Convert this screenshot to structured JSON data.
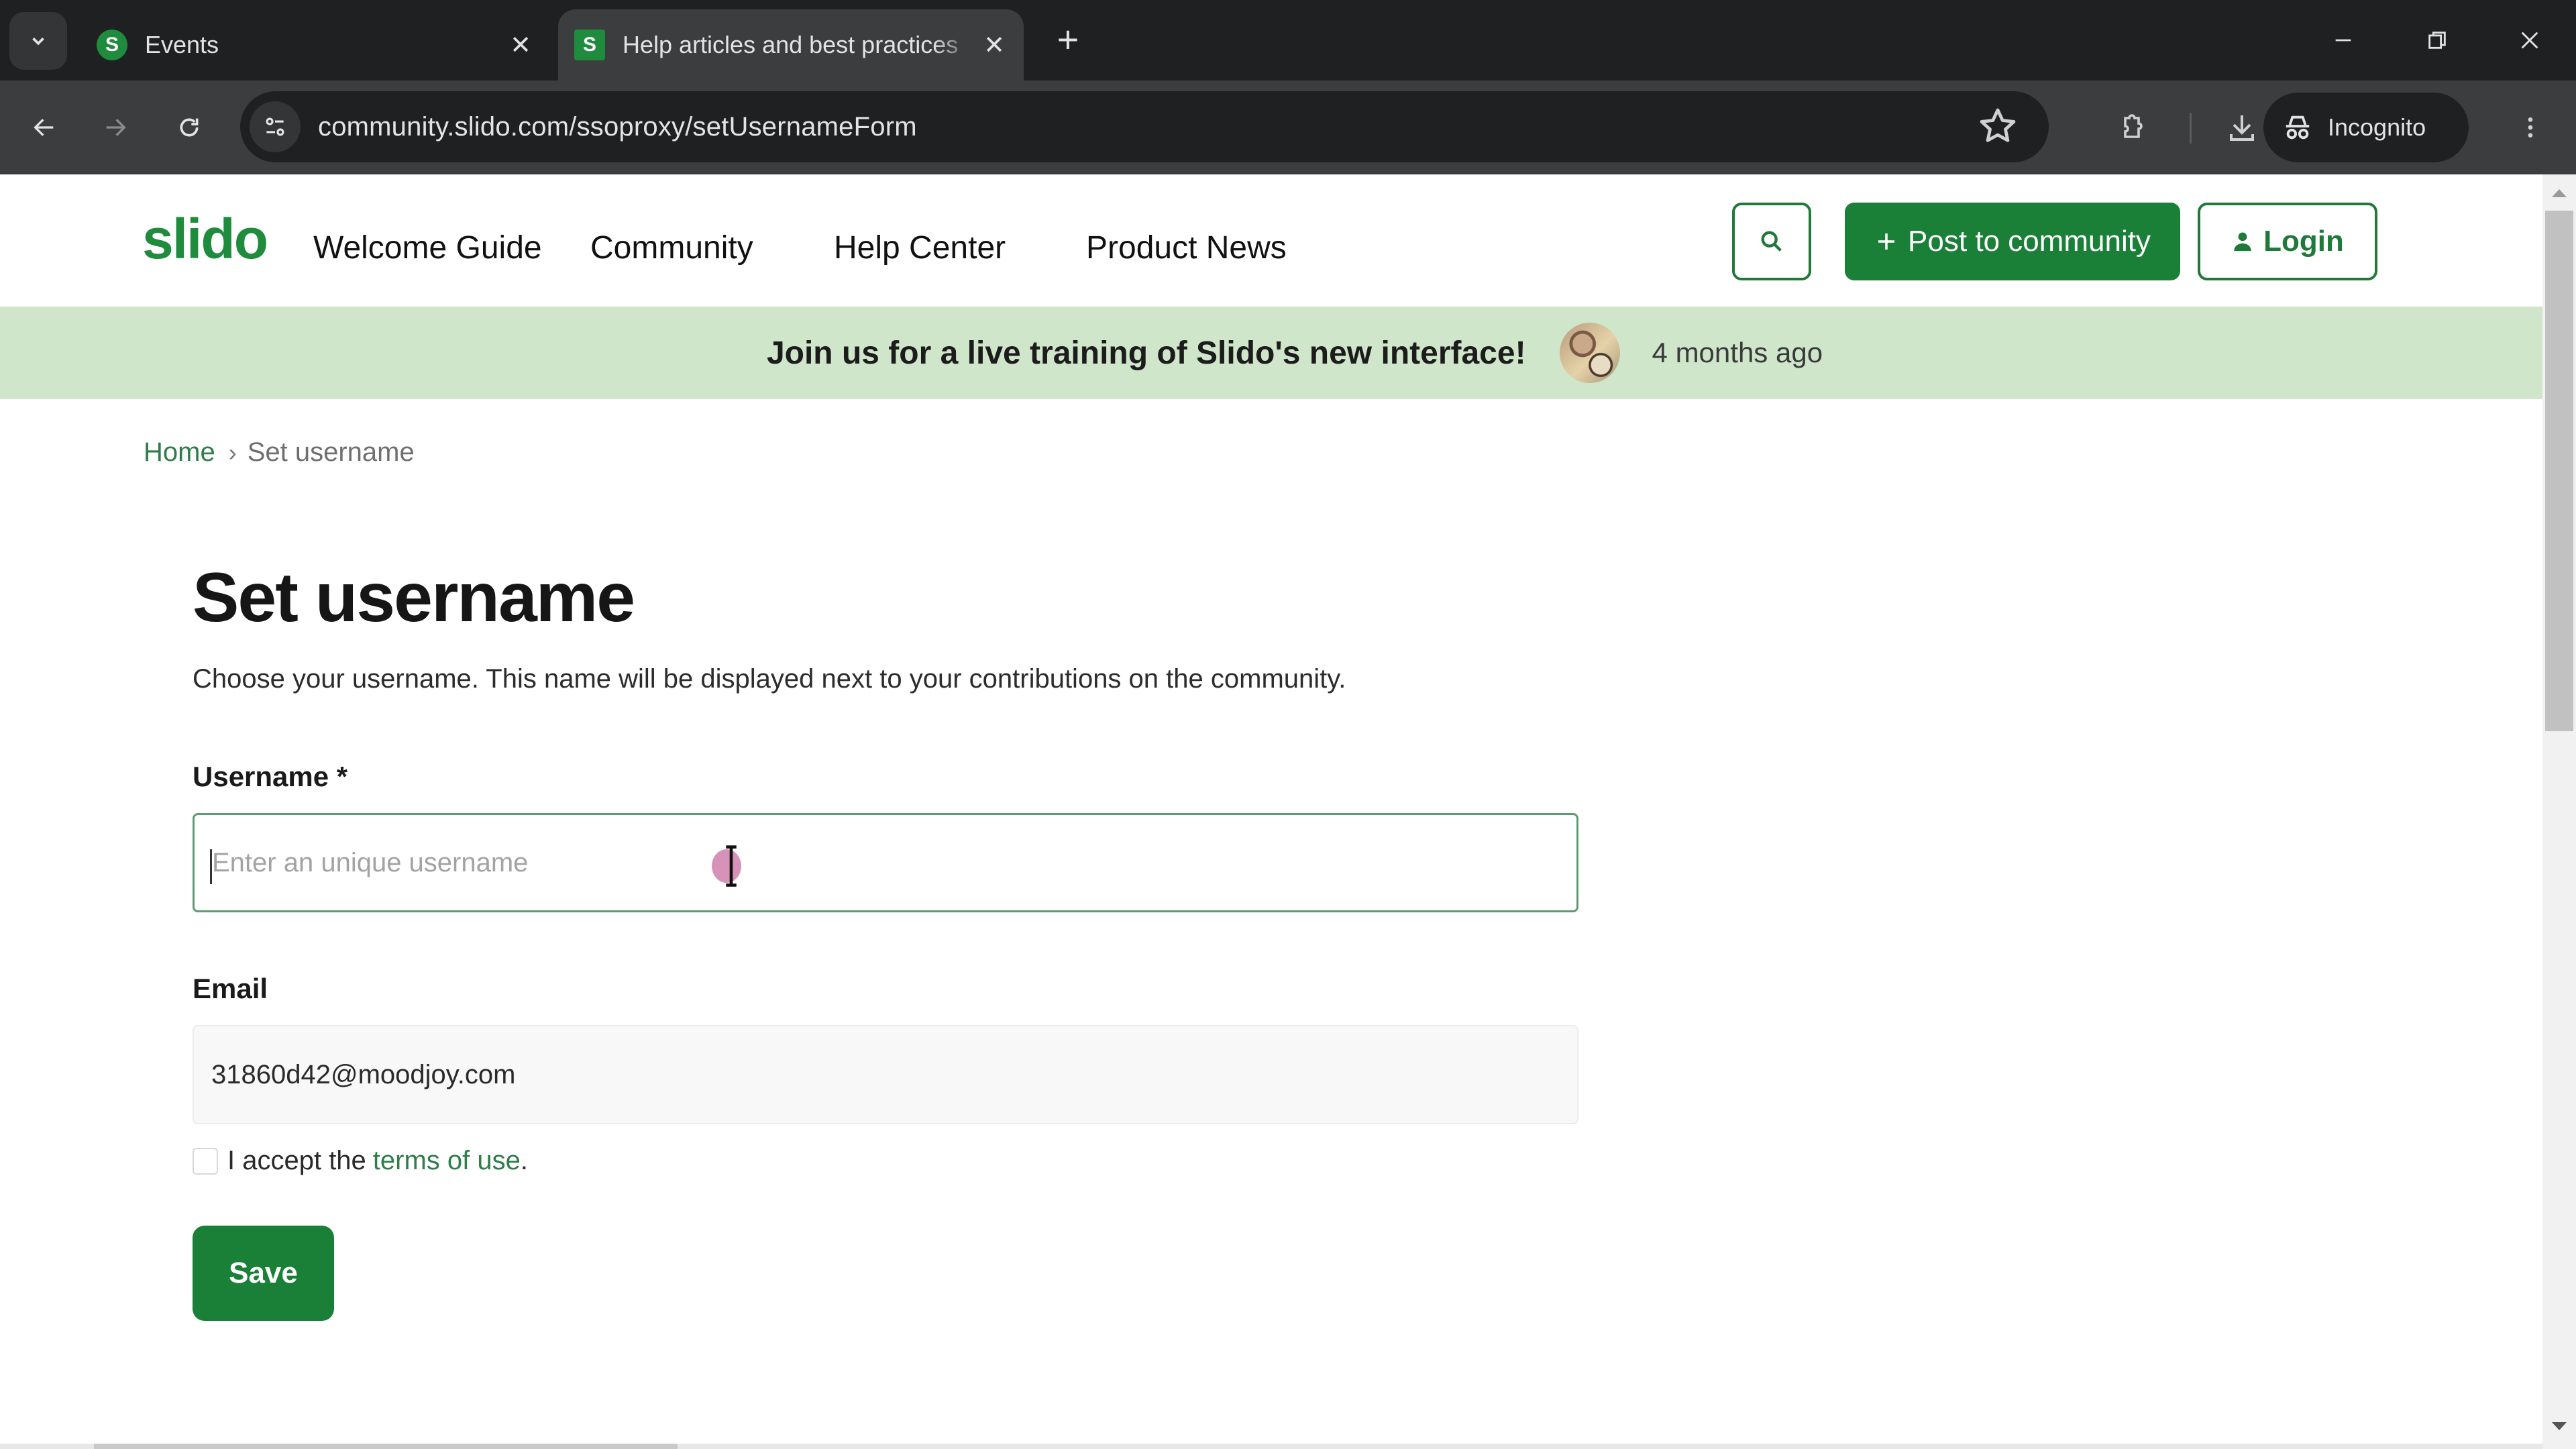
{
  "browser": {
    "tabs": [
      {
        "title": "Events",
        "favicon": "S",
        "active": false
      },
      {
        "title": "Help articles and best practices",
        "favicon": "S",
        "active": true
      }
    ],
    "url": "community.slido.com/ssoproxy/setUsernameForm",
    "incognito_label": "Incognito"
  },
  "site": {
    "logo": "slido",
    "nav": [
      "Welcome Guide",
      "Community",
      "Help Center",
      "Product News"
    ],
    "post_button": "Post to community",
    "login_button": "Login"
  },
  "banner": {
    "text": "Join us for a live training of Slido's new interface!",
    "time": "4 months ago"
  },
  "breadcrumb": {
    "home": "Home",
    "current": "Set username"
  },
  "form": {
    "title": "Set username",
    "description": "Choose your username. This name will be displayed next to your contributions on the community.",
    "username_label": "Username *",
    "username_value": "",
    "username_placeholder": "Enter an unique username",
    "email_label": "Email",
    "email_value": "31860d42@moodjoy.com",
    "terms_prefix": "I accept the",
    "terms_link": "terms of use",
    "terms_suffix": ".",
    "terms_checked": false,
    "save_label": "Save"
  },
  "colors": {
    "brand_green": "#1a7f37",
    "banner_bg": "#cfe6cb",
    "link_green": "#2e7d4a"
  }
}
